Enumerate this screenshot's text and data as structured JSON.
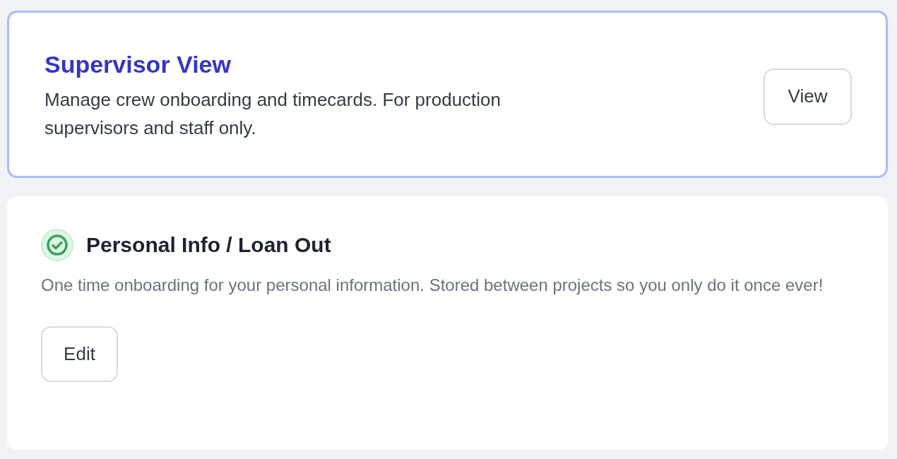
{
  "supervisor_card": {
    "title": "Supervisor View",
    "description": "Manage crew onboarding and timecards. For production supervisors and staff only.",
    "button": "View"
  },
  "personal_card": {
    "title": "Personal Info / Loan Out",
    "completed": true,
    "description": "One time onboarding for your personal information. Stored between projects so you only do it once ever!",
    "button": "Edit"
  }
}
